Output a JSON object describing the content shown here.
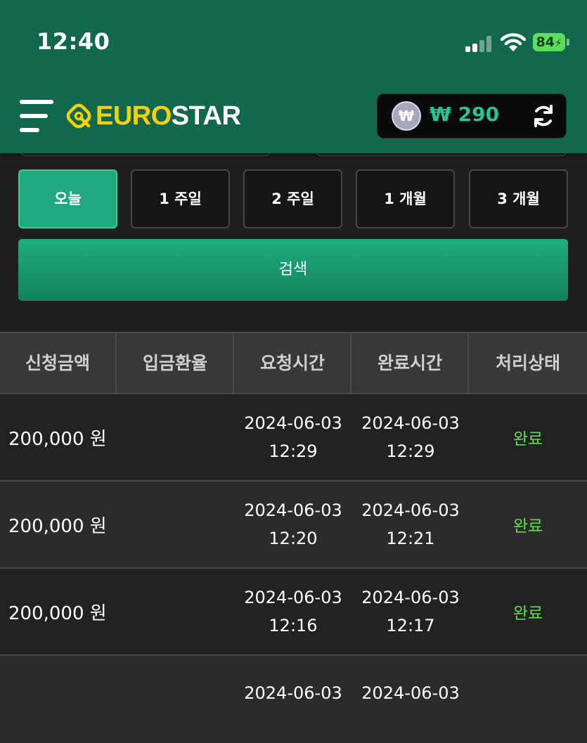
{
  "status_bar": {
    "time": "12:40",
    "battery": "84"
  },
  "header": {
    "logo_euro": "EURO",
    "logo_star": "STAR",
    "coin_symbol": "₩",
    "balance": "₩ 290"
  },
  "period_buttons": [
    "오늘",
    "1 주일",
    "2 주일",
    "1 개월",
    "3 개월"
  ],
  "active_period": 0,
  "search_label": "검색",
  "table": {
    "headers": [
      "신청금액",
      "입금환율",
      "요청시간",
      "완료시간",
      "처리상태"
    ],
    "rows": [
      {
        "amount": "200,000 원",
        "rate": "",
        "req_date": "2024-06-03",
        "req_time": "12:29",
        "done_date": "2024-06-03",
        "done_time": "12:29",
        "status": "완료"
      },
      {
        "amount": "200,000 원",
        "rate": "",
        "req_date": "2024-06-03",
        "req_time": "12:20",
        "done_date": "2024-06-03",
        "done_time": "12:21",
        "status": "완료"
      },
      {
        "amount": "200,000 원",
        "rate": "",
        "req_date": "2024-06-03",
        "req_time": "12:16",
        "done_date": "2024-06-03",
        "done_time": "12:17",
        "status": "완료"
      },
      {
        "amount": "",
        "rate": "",
        "req_date": "2024-06-03",
        "req_time": "",
        "done_date": "2024-06-03",
        "done_time": "",
        "status": ""
      }
    ]
  },
  "colors": {
    "header_bg": "#11684c",
    "accent": "#1eaa7e",
    "balance": "#28c493",
    "status_done": "#5ee04c",
    "logo_yellow": "#f6d300"
  }
}
